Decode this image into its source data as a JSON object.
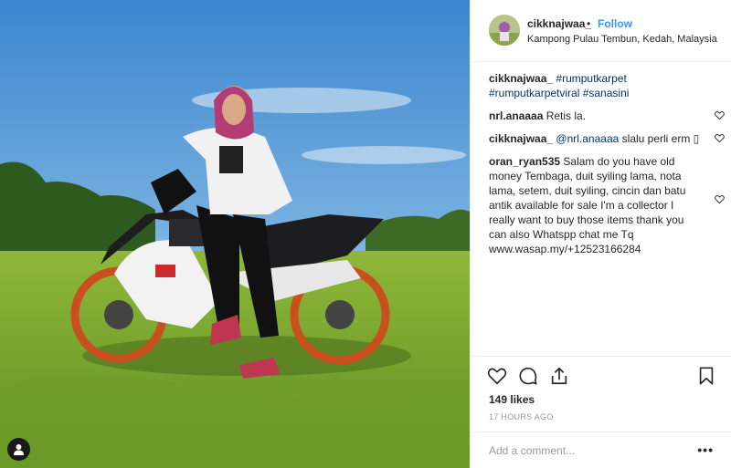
{
  "post": {
    "username": "cikknajwaa_",
    "dot": "•",
    "follow_label": "Follow",
    "location": "Kampong Pulau Tembun, Kedah, Malaysia",
    "caption": {
      "user": "cikknajwaa_",
      "text_tags": "#rumputkarpet #rumputkarpetviral #sanasini"
    },
    "comments": [
      {
        "user": "nrl.anaaaa",
        "mention": "",
        "text": "Retis la."
      },
      {
        "user": "cikknajwaa_",
        "mention": "@nrl.anaaaa",
        "text": "slalu perli erm ▯"
      },
      {
        "user": "oran_ryan535",
        "mention": "",
        "text": "Salam do you have old money Tembaga, duit syiling lama, nota lama, setem, duit syiling, cincin dan batu antik available for sale I'm a collector I really want to buy those items thank you can also Whatspp chat me Tq www.wasap.my/+12523166284"
      }
    ],
    "likes": "149 likes",
    "time": "17 HOURS AGO",
    "add_comment_placeholder": "Add a comment...",
    "more_label": "•••"
  },
  "icons": {
    "like": "heart-icon",
    "comment": "comment-icon",
    "share": "share-icon",
    "save": "bookmark-icon",
    "comment_like": "heart-icon",
    "user_tag": "user-icon"
  },
  "colors": {
    "follow": "#3897f0",
    "mention": "#003569",
    "muted": "#999999",
    "text": "#262626"
  }
}
